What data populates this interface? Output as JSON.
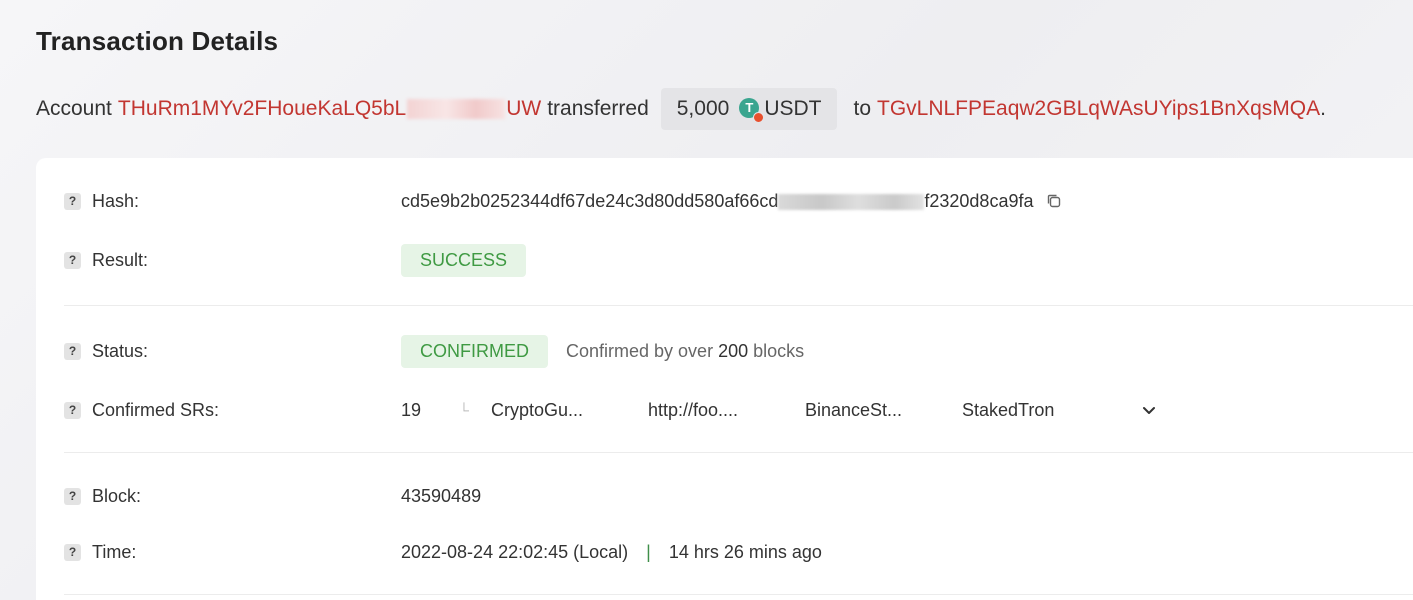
{
  "page_title": "Transaction Details",
  "summary": {
    "prefix": "Account",
    "from_address_start": "THuRm1MYv2FHoueKaLQ5bL",
    "from_address_end": "UW",
    "verb": "transferred",
    "amount": "5,000",
    "token": "USDT",
    "to_word": "to",
    "to_address": "TGvLNLFPEaqw2GBLqWAsUYips1BnXqsMQA",
    "period": "."
  },
  "details": {
    "hash": {
      "label": "Hash:",
      "value_start": "cd5e9b2b0252344df67de24c3d80dd580af66cd",
      "value_end": "f2320d8ca9fa"
    },
    "result": {
      "label": "Result:",
      "value": "SUCCESS"
    },
    "status": {
      "label": "Status:",
      "value": "CONFIRMED",
      "note_prefix": "Confirmed by over",
      "note_count": "200",
      "note_suffix": "blocks"
    },
    "confirmed_srs": {
      "label": "Confirmed SRs:",
      "count": "19",
      "items": [
        "CryptoGu...",
        "http://foo....",
        "BinanceSt...",
        "StakedTron"
      ]
    },
    "block": {
      "label": "Block:",
      "value": "43590489"
    },
    "time": {
      "label": "Time:",
      "value": "2022-08-24 22:02:45 (Local)",
      "separator": "|",
      "ago": "14 hrs 26 mins ago"
    }
  },
  "icons": {
    "help": "question-mark-icon",
    "copy": "copy-icon",
    "expand": "chevron-down-icon",
    "token": "usdt-token-icon"
  },
  "colors": {
    "address": "#c23631",
    "success_text": "#3f9a43",
    "success_bg": "#e6f4e6"
  }
}
